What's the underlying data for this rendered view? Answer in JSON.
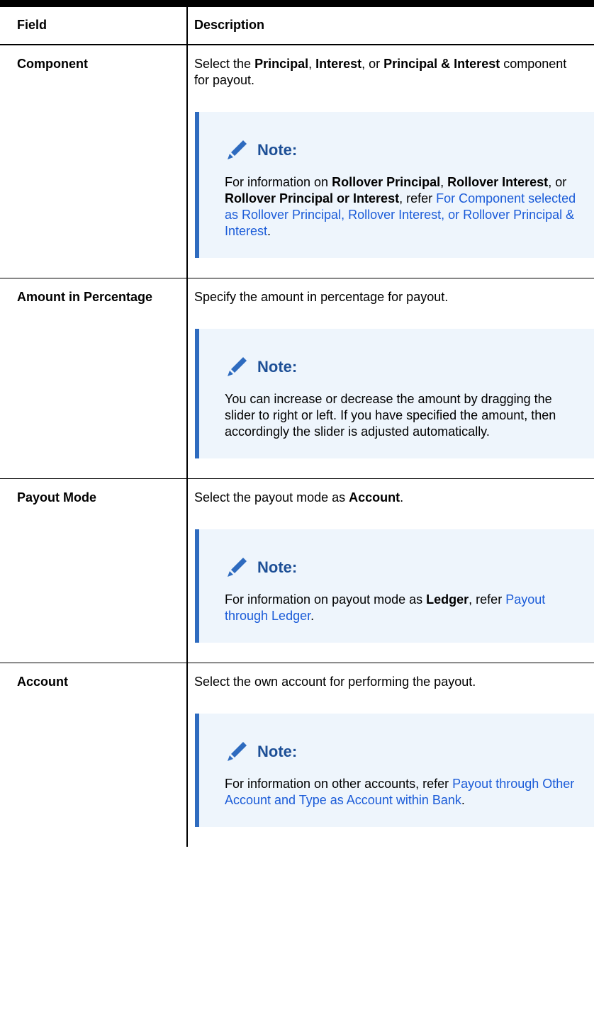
{
  "table": {
    "header": {
      "field": "Field",
      "description": "Description"
    },
    "note_title": "Note:",
    "rows": [
      {
        "field": "Component",
        "desc": {
          "p1": "Select the ",
          "b1": "Principal",
          "p2": ", ",
          "b2": "Interest",
          "p3": ", or ",
          "b3": "Principal & Interest",
          "p4": " component for payout."
        },
        "note": {
          "p1": "For information on ",
          "b1": "Rollover Principal",
          "p2": ", ",
          "b2": "Rollover Interest",
          "p3": ", or ",
          "b3": "Rollover Principal or Interest",
          "p4": ", refer ",
          "link": "For Component selected as Rollover Principal, Rollover Interest, or Rollover Principal & Interest",
          "p5": "."
        }
      },
      {
        "field": "Amount in Percentage",
        "desc": {
          "p1": "Specify the amount in percentage for payout."
        },
        "note": {
          "p1": "You can increase or decrease the amount by dragging the slider to right or left. If you have specified the amount, then accordingly the slider is adjusted automatically."
        }
      },
      {
        "field": "Payout Mode",
        "desc": {
          "p1": "Select the payout mode as ",
          "b1": "Account",
          "p2": "."
        },
        "note": {
          "p1": "For information on payout mode as ",
          "b1": "Ledger",
          "p2": ", refer ",
          "link": "Payout through Ledger",
          "p3": "."
        }
      },
      {
        "field": "Account",
        "desc": {
          "p1": "Select the own account for performing the payout."
        },
        "note": {
          "p1": "For information on other accounts, refer ",
          "link": "Payout through Other Account and Type as Account within Bank",
          "p2": "."
        }
      }
    ]
  },
  "colors": {
    "note_bg": "#eef5fc",
    "note_bar": "#2e6bbf",
    "note_title": "#1d4f96",
    "link": "#1a5bd8"
  },
  "icons": {
    "note": "pencil-icon"
  }
}
